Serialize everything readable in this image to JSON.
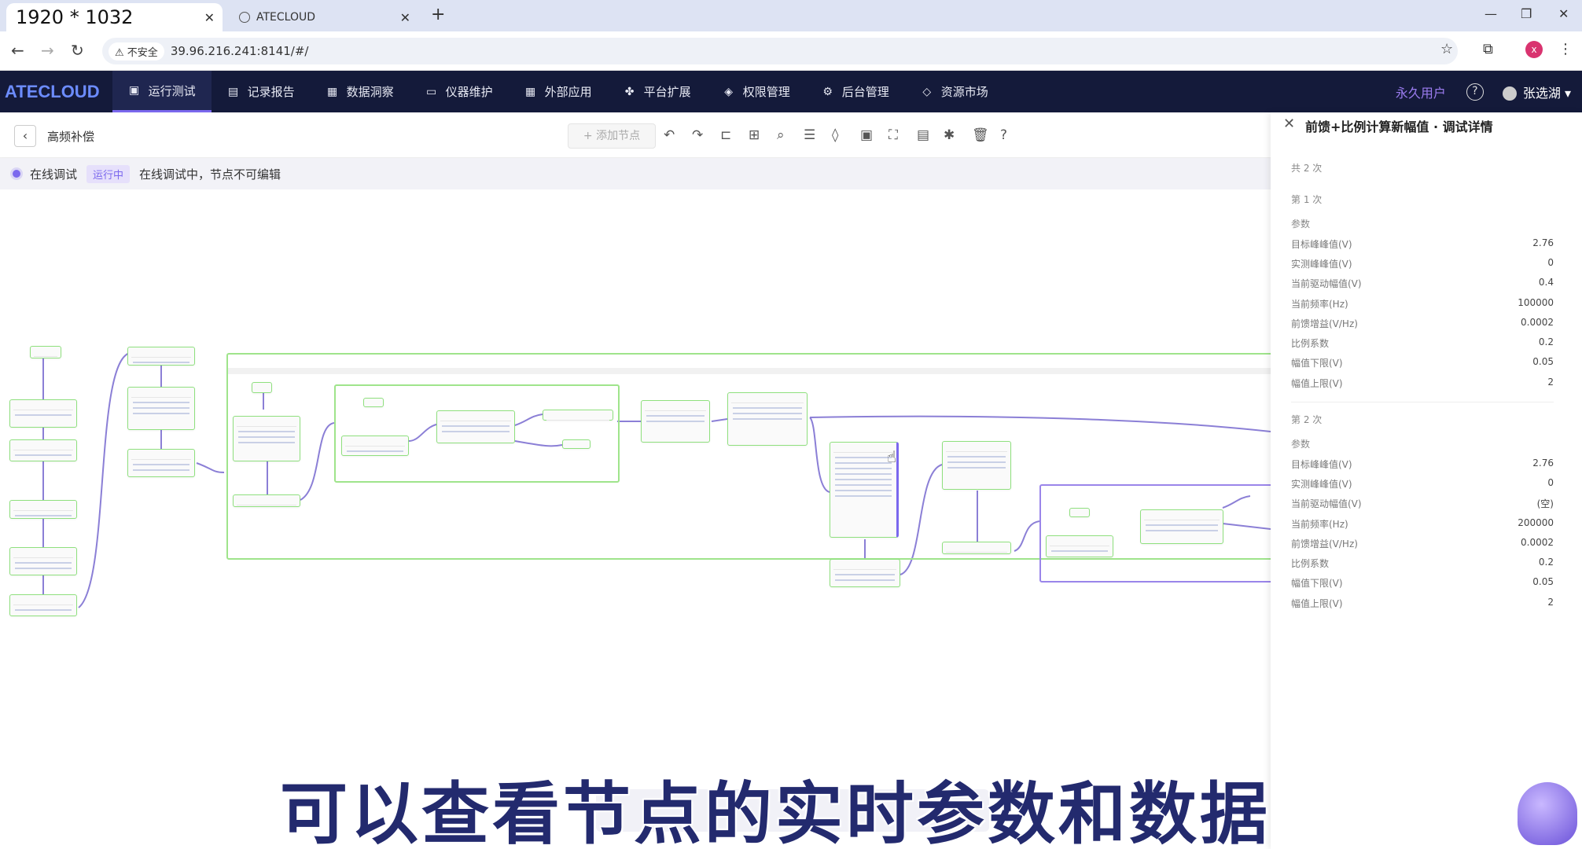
{
  "browser": {
    "active_tab_title": "1920 * 1032",
    "inactive_tab_title": "ATECLOUD",
    "security_label": "不安全",
    "url": "39.96.216.241:8141/#/",
    "profile_initial": "x"
  },
  "nav": {
    "logo": "ATECLOUD",
    "items": [
      {
        "label": "运行测试",
        "icon": "monitor-icon"
      },
      {
        "label": "记录报告",
        "icon": "clipboard-icon"
      },
      {
        "label": "数据洞察",
        "icon": "chart-icon"
      },
      {
        "label": "仪器维护",
        "icon": "instrument-icon"
      },
      {
        "label": "外部应用",
        "icon": "grid-icon"
      },
      {
        "label": "平台扩展",
        "icon": "cubes-icon"
      },
      {
        "label": "权限管理",
        "icon": "shield-icon"
      },
      {
        "label": "后台管理",
        "icon": "gears-icon"
      },
      {
        "label": "资源市场",
        "icon": "tag-icon"
      }
    ],
    "permission": "永久用户",
    "username": "张选湖"
  },
  "toolbar": {
    "flow_name": "高频补偿",
    "add_node": "+ 添加节点"
  },
  "status": {
    "mode": "在线调试",
    "badge": "运行中",
    "message": "在线调试中，节点不可编辑"
  },
  "panel": {
    "title": "前馈+比例计算新幅值 · 调试详情",
    "total": "共 2 次",
    "runs": [
      {
        "label": "第 1 次",
        "section": "参数",
        "params": [
          {
            "key": "目标峰峰值(V)",
            "value": "2.76"
          },
          {
            "key": "实测峰峰值(V)",
            "value": "0"
          },
          {
            "key": "当前驱动幅值(V)",
            "value": "0.4"
          },
          {
            "key": "当前频率(Hz)",
            "value": "100000"
          },
          {
            "key": "前馈增益(V/Hz)",
            "value": "0.0002"
          },
          {
            "key": "比例系数",
            "value": "0.2"
          },
          {
            "key": "幅值下限(V)",
            "value": "0.05"
          },
          {
            "key": "幅值上限(V)",
            "value": "2"
          }
        ]
      },
      {
        "label": "第 2 次",
        "section": "参数",
        "params": [
          {
            "key": "目标峰峰值(V)",
            "value": "2.76"
          },
          {
            "key": "实测峰峰值(V)",
            "value": "0"
          },
          {
            "key": "当前驱动幅值(V)",
            "value": "(空)"
          },
          {
            "key": "当前频率(Hz)",
            "value": "200000"
          },
          {
            "key": "前馈增益(V/Hz)",
            "value": "0.0002"
          },
          {
            "key": "比例系数",
            "value": "0.2"
          },
          {
            "key": "幅值下限(V)",
            "value": "0.05"
          },
          {
            "key": "幅值上限(V)",
            "value": "2"
          }
        ]
      }
    ]
  },
  "subtitle": "可以查看节点的实时参数和数据",
  "colors": {
    "nav_bg": "#141a3a",
    "accent": "#7b68ee",
    "node_border": "#8fe07e",
    "group_purple": "#9a85ea"
  }
}
